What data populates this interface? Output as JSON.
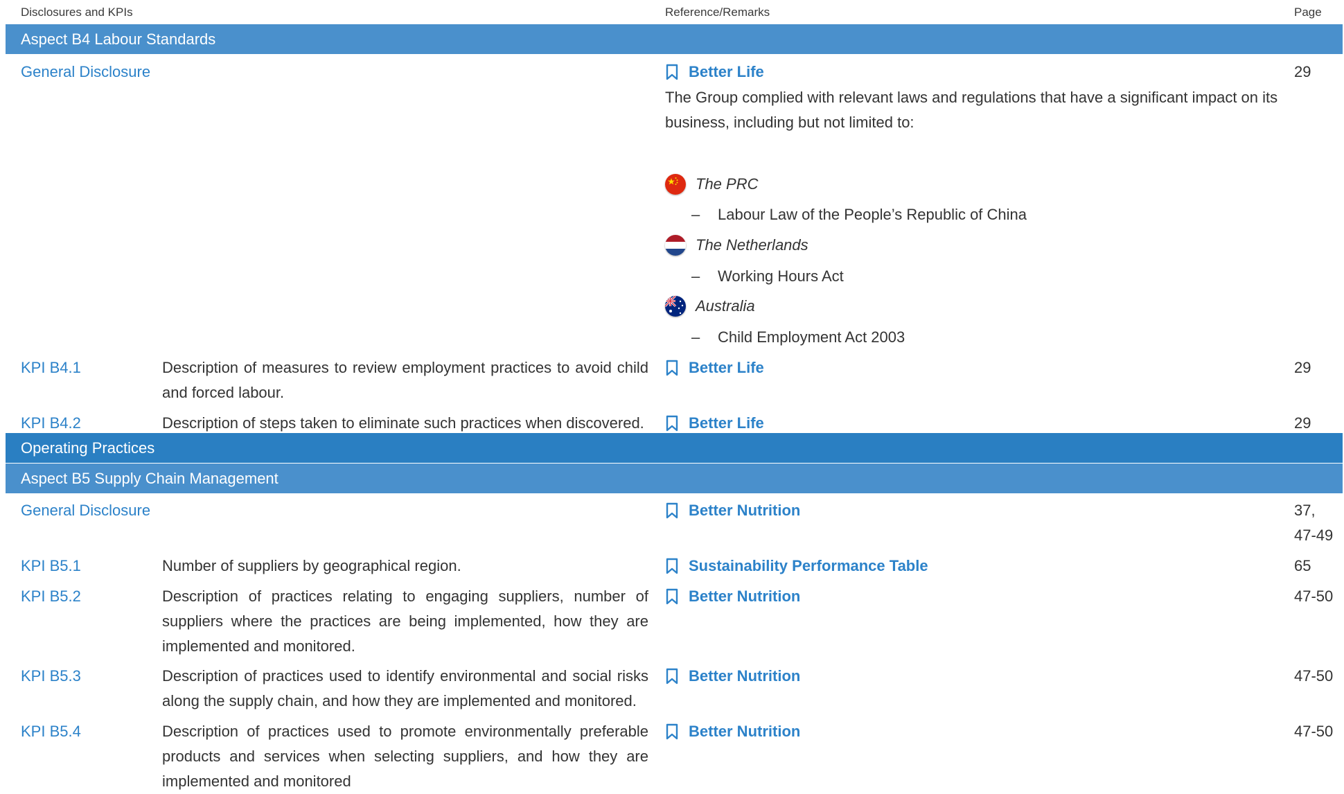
{
  "header": {
    "col1": "Disclosures and KPIs",
    "col2": "Reference/Remarks",
    "col3": "Page"
  },
  "bands": {
    "b4": "Aspect B4 Labour Standards",
    "operating": "Operating Practices",
    "b5": "Aspect B5 Supply Chain Management"
  },
  "b4": {
    "general": {
      "code": "General Disclosure",
      "ref": "Better Life",
      "page": "29",
      "remarks": "The Group complied with relevant laws and regulations that have a significant impact on its business, including but not limited to:",
      "countries": [
        {
          "name": "The PRC",
          "flag": "china-flag-icon",
          "law": "Labour Law of the People’s Republic of China"
        },
        {
          "name": "The Netherlands",
          "flag": "netherlands-flag-icon",
          "law": "Working Hours Act"
        },
        {
          "name": "Australia",
          "flag": "australia-flag-icon",
          "law": "Child Employment Act 2003"
        }
      ]
    },
    "kpis": [
      {
        "code": "KPI B4.1",
        "desc": "Description of measures to review employment practices to avoid child and forced labour.",
        "ref": "Better Life",
        "page": "29"
      },
      {
        "code": "KPI B4.2",
        "desc": "Description of steps taken to eliminate such practices when discovered.",
        "ref": "Better Life",
        "page": "29"
      }
    ]
  },
  "b5": {
    "general": {
      "code": "General Disclosure",
      "ref": "Better Nutrition",
      "page_line1": "37,",
      "page_line2": "47-49"
    },
    "kpis": [
      {
        "code": "KPI B5.1",
        "desc": "Number of suppliers by geographical region.",
        "ref": "Sustainability Performance Table",
        "page": "65"
      },
      {
        "code": "KPI B5.2",
        "desc": "Description of practices relating to engaging suppliers, number of suppliers where the practices are being implemented, how they are implemented and monitored.",
        "ref": "Better Nutrition",
        "page": "47-50"
      },
      {
        "code": "KPI B5.3",
        "desc": "Description of practices used to identify environmental and social risks along the supply chain, and how they are implemented and monitored.",
        "ref": "Better Nutrition",
        "page": "47-50"
      },
      {
        "code": "KPI B5.4",
        "desc": "Description of practices used to promote environmentally preferable products and services when selecting suppliers, and how they are implemented and monitored",
        "ref": "Better Nutrition",
        "page": "47-50"
      }
    ]
  },
  "icons": {
    "reference": "bookmark-icon"
  },
  "colors": {
    "accent_text": "#2c82c9",
    "aspect_band": "#4a90cc",
    "section_band": "#2a7fc2"
  }
}
